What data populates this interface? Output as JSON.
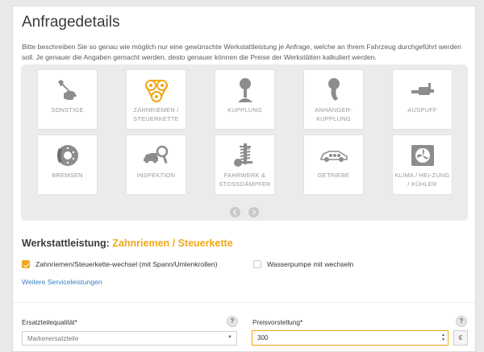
{
  "page": {
    "title": "Anfragedetails",
    "description": "Bitte beschreiben Sie so genau wie möglich nur eine gewünschte Werkstattleistung je Anfrage, welche an Ihrem Fahrzeug durchgeführt werden soll. Je genauer die Angaben gemacht werden, desto genauer können die Preise der Werkstätten kalkuliert werden."
  },
  "services": [
    {
      "label": "SONSTIGE",
      "icon": "wrench-fist-icon"
    },
    {
      "label": "ZAHNRIEMEN / STEUERKETTE",
      "icon": "timing-belt-icon",
      "selected": true
    },
    {
      "label": "KUPPLUNG",
      "icon": "clutch-icon"
    },
    {
      "label": "ANHÄNGER-KUPPLUNG",
      "icon": "trailer-hitch-icon"
    },
    {
      "label": "AUSPUFF",
      "icon": "exhaust-icon"
    },
    {
      "label": "BREMSEN",
      "icon": "brake-disc-icon"
    },
    {
      "label": "INSPEKTION",
      "icon": "inspection-icon"
    },
    {
      "label": "FAHRWERK & STOSSDÄMPFER",
      "icon": "suspension-icon"
    },
    {
      "label": "GETRIEBE",
      "icon": "gearbox-icon"
    },
    {
      "label": "KLIMA / HEI-ZUNG / KÜHLER",
      "icon": "climate-icon"
    }
  ],
  "werkstatt": {
    "label": "Werkstattleistung:",
    "value": "Zahnriemen / Steuerkette"
  },
  "options": {
    "option1": {
      "label": "Zahnriemen/Steuerkette-wechsel (mit Spann/Umlenkrollen)",
      "checked": true
    },
    "option2": {
      "label": "Wasserpumpe mit wechseln",
      "checked": false
    }
  },
  "more_link": "Weitere Serviceleistungen",
  "form": {
    "ersatzteil_label": "Ersatzteilequalität*",
    "ersatzteil_value": "Markenersatzteile",
    "preis_label": "Preisvorstellung*",
    "preis_value": "300",
    "currency": "€",
    "help": "?"
  },
  "colors": {
    "accent": "#f0a818",
    "icon_gray": "#8d8d8d",
    "link": "#3b7fc4"
  }
}
